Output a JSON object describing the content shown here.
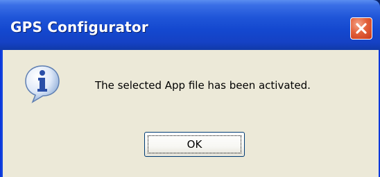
{
  "dialog": {
    "title": "GPS Configurator",
    "message": "The selected App file has been activated.",
    "ok_label": "OK",
    "icon": "information-icon",
    "close_icon": "close-icon"
  },
  "colors": {
    "titlebar": "#1448cf",
    "close_button": "#e2603a",
    "client_background": "#ece9d8",
    "button_border": "#003c74"
  }
}
